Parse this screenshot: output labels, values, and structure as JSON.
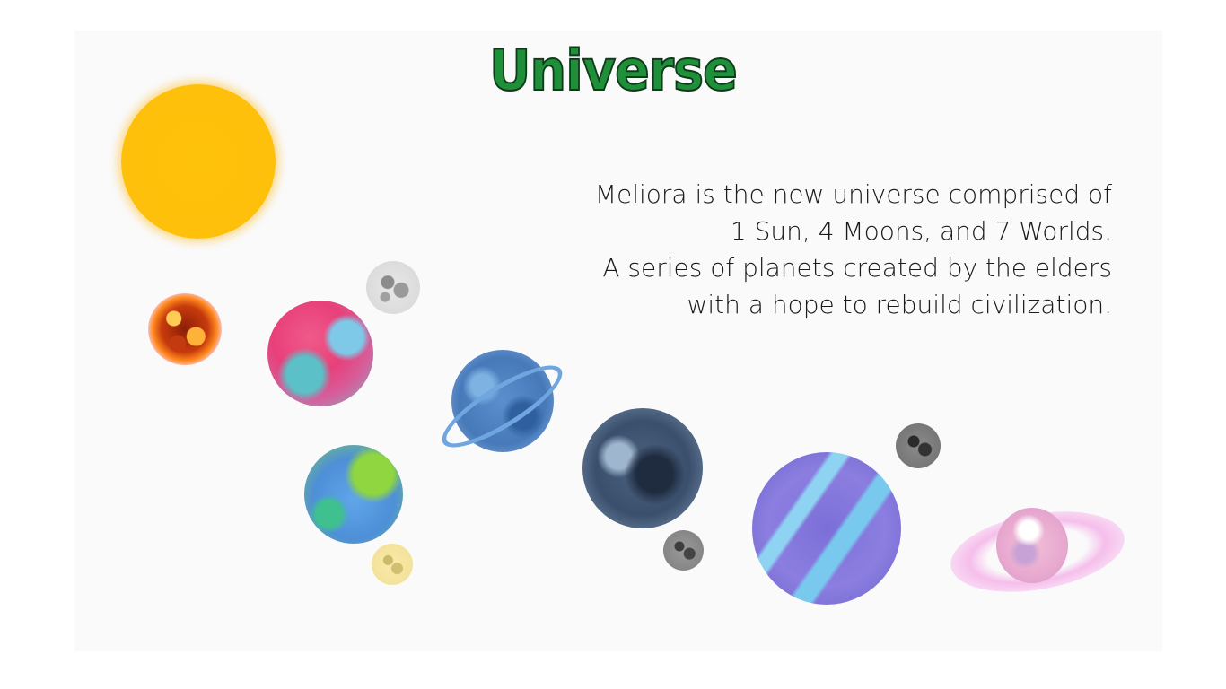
{
  "slide": {
    "title": "Universe",
    "description_lines": [
      "Meliora is the new universe comprised of",
      "1 Sun, 4 Moons, and 7 Worlds.",
      "A series of planets created by the elders",
      "with a hope to rebuild civilization."
    ]
  },
  "colors": {
    "title": "#1f8f3a",
    "title_outline": "#0f3b1a",
    "sun": "#ffc20a",
    "slide_background": "#fafafb"
  },
  "illustrations": [
    "sun",
    "fire-planet",
    "gray-moon",
    "pink-planet",
    "ringed-blue-planet",
    "green-planet",
    "yellow-moon",
    "dark-blue-planet",
    "dark-gray-moon",
    "purple-planet",
    "charcoal-moon",
    "ringed-pink-planet"
  ]
}
